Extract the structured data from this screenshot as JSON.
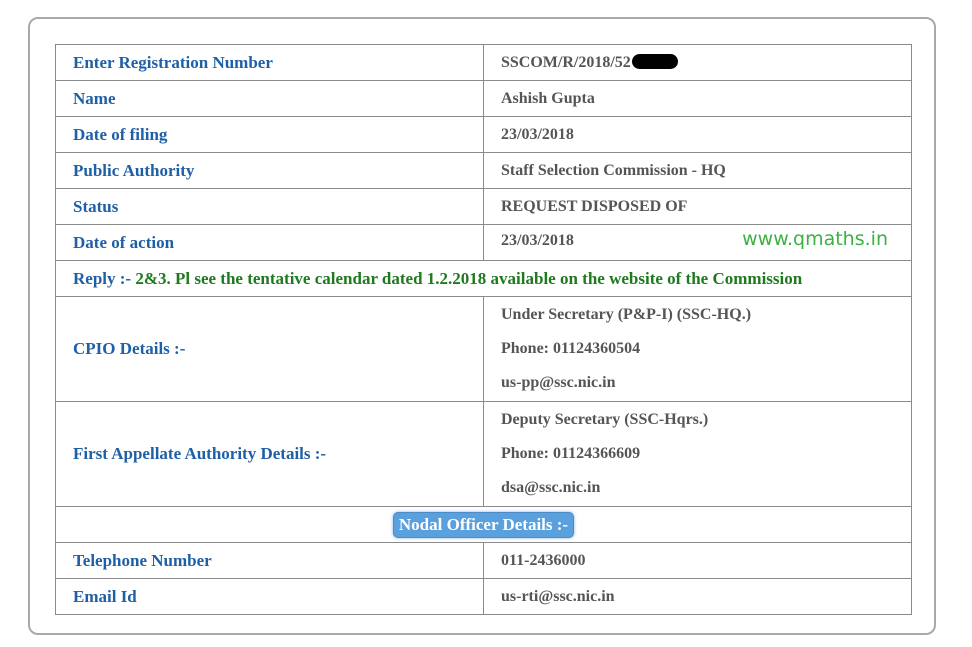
{
  "rows": {
    "registration": {
      "label": "Enter Registration Number",
      "value": "SSCOM/R/2018/52"
    },
    "name": {
      "label": "Name",
      "value": "Ashish Gupta"
    },
    "filing": {
      "label": "Date of filing",
      "value": "23/03/2018"
    },
    "authority": {
      "label": "Public Authority",
      "value": "Staff Selection Commission - HQ"
    },
    "status": {
      "label": "Status",
      "value": "REQUEST DISPOSED OF"
    },
    "action": {
      "label": "Date of action",
      "value": "23/03/2018"
    }
  },
  "watermark": "www.qmaths.in",
  "reply": {
    "label": "Reply :-",
    "text": "2&3. Pl see the tentative calendar dated 1.2.2018 available on the website of the Commission"
  },
  "cpio": {
    "label": "CPIO Details :-",
    "designation": "Under Secretary (P&P-I) (SSC-HQ.)",
    "phone": "Phone: 01124360504",
    "email": "us-pp@ssc.nic.in"
  },
  "appellate": {
    "label": "First Appellate Authority Details :-",
    "designation": "Deputy Secretary (SSC-Hqrs.)",
    "phone": "Phone: 01124366609",
    "email": "dsa@ssc.nic.in"
  },
  "nodal": {
    "header": "Nodal Officer Details :-",
    "telephone": {
      "label": "Telephone Number",
      "value": "011-2436000"
    },
    "email": {
      "label": "Email Id",
      "value": "us-rti@ssc.nic.in"
    }
  },
  "colors": {
    "label_blue": "#1f5fa6",
    "value_gray": "#555555",
    "reply_green": "#1f7a1f",
    "watermark_green": "#3cb043",
    "nodal_button": "#5aa0dc"
  }
}
